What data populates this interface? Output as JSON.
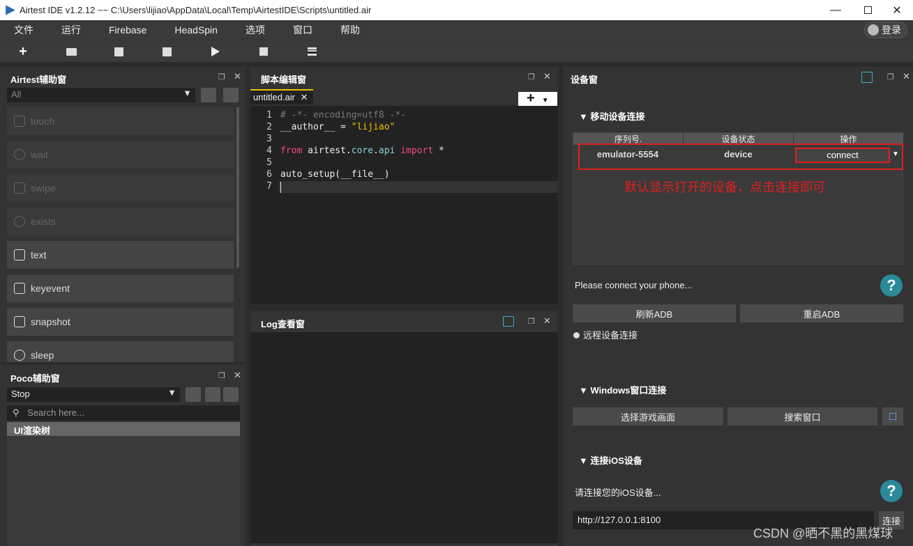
{
  "window": {
    "title": "Airtest IDE v1.2.12 ~~ C:\\Users\\lijiao\\AppData\\Local\\Temp\\AirtestIDE\\Scripts\\untitled.air"
  },
  "menu": [
    "文件",
    "运行",
    "Firebase",
    "HeadSpin",
    "选项",
    "窗口",
    "帮助"
  ],
  "login_label": "登录",
  "airtest_panel": {
    "title": "Airtest辅助窗",
    "filter": "All",
    "buttons": [
      {
        "label": "touch",
        "enabled": false
      },
      {
        "label": "wait",
        "enabled": false
      },
      {
        "label": "swipe",
        "enabled": false
      },
      {
        "label": "exists",
        "enabled": false
      },
      {
        "label": "text",
        "enabled": true
      },
      {
        "label": "keyevent",
        "enabled": true
      },
      {
        "label": "snapshot",
        "enabled": true
      },
      {
        "label": "sleep",
        "enabled": true
      }
    ]
  },
  "poco_panel": {
    "title": "Poco辅助窗",
    "mode": "Stop",
    "search_placeholder": "Search here...",
    "tree_root": "UI渲染树"
  },
  "editor": {
    "title": "脚本编辑窗",
    "tab": "untitled.air",
    "lines": [
      {
        "n": "1"
      },
      {
        "n": "2"
      },
      {
        "n": "3"
      },
      {
        "n": "4"
      },
      {
        "n": "5"
      },
      {
        "n": "6"
      },
      {
        "n": "7"
      }
    ],
    "code": {
      "l1": "# -*- encoding=utf8 -*-",
      "l2a": "__author__ = ",
      "l2b": "\"lijiao\"",
      "l4a": "from",
      "l4b": " airtest.",
      "l4c": "core",
      "l4d": ".",
      "l4e": "api",
      "l4f": " import",
      "l4g": " *",
      "l6": "auto_setup(__file__)"
    }
  },
  "log": {
    "title": "Log查看窗"
  },
  "device": {
    "title": "设备窗",
    "mobile_section": "移动设备连接",
    "table_headers": [
      "序列号.",
      "设备状态",
      "操作"
    ],
    "row": {
      "serial": "emulator-5554",
      "status": "device",
      "action": "connect"
    },
    "annotation": "默认显示打开的设备，点击连接即可",
    "hint": "Please connect your phone...",
    "refresh_adb": "刷新ADB",
    "restart_adb": "重启ADB",
    "remote": "远程设备连接",
    "windows_section": "Windows窗口连接",
    "select_game": "选择游戏画面",
    "search_window": "搜索窗口",
    "ios_section": "连接iOS设备",
    "ios_hint": "请连接您的iOS设备...",
    "ios_url": "http://127.0.0.1:8100",
    "ios_connect": "连接",
    "help": "?"
  },
  "watermark": "CSDN @晒不黑的黑煤球",
  "colors": {
    "annotation_red": "#e0201c",
    "help_teal": "#2a8a9a",
    "accent": "#f0c000"
  }
}
